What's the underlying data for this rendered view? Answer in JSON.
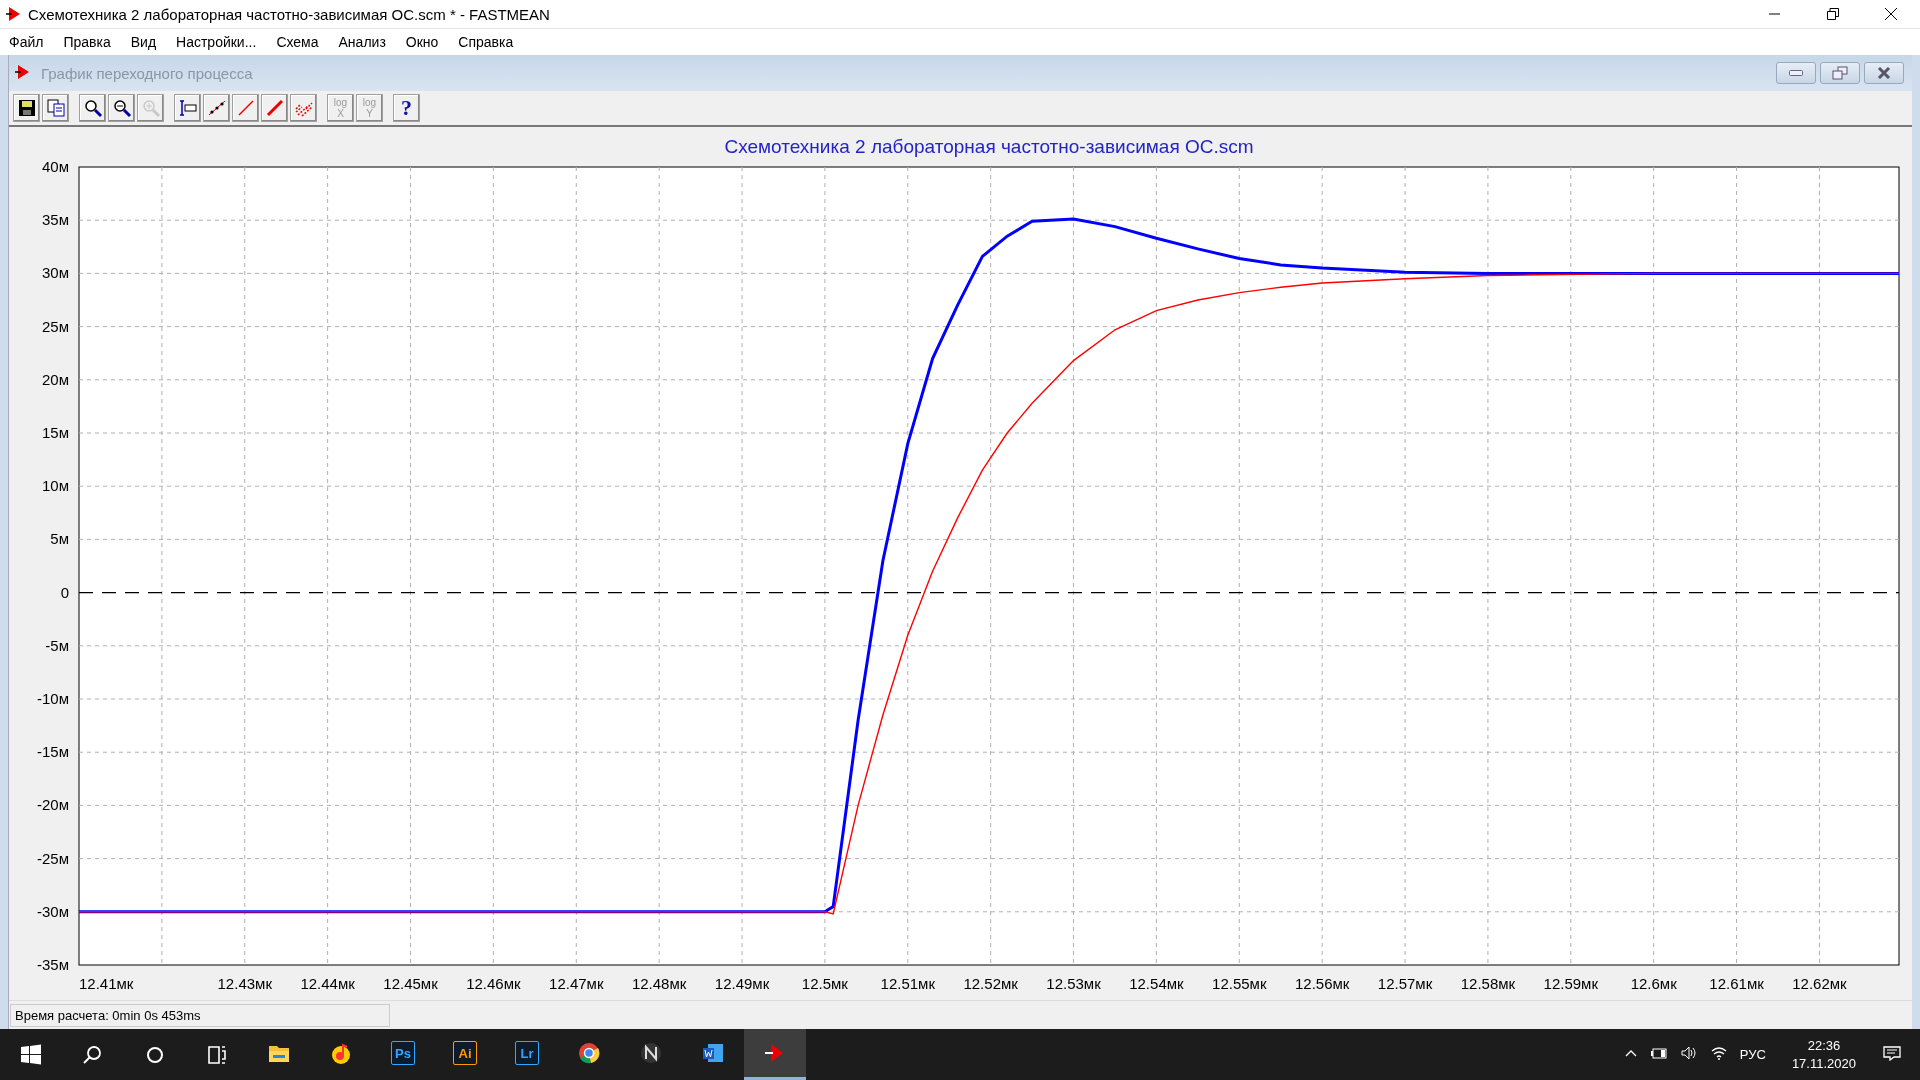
{
  "window": {
    "title": "Схемотехника 2 лабораторная частотно-зависимая ОС.scm * - FASTMEAN"
  },
  "menu": [
    "Файл",
    "Правка",
    "Вид",
    "Настройки...",
    "Схема",
    "Анализ",
    "Окно",
    "Справка"
  ],
  "child_window": {
    "title": "График переходного процесса"
  },
  "toolbar": [
    {
      "kind": "save",
      "disabled": false
    },
    {
      "kind": "copy",
      "disabled": false
    },
    {
      "kind": "zoom",
      "disabled": false
    },
    {
      "kind": "zoom-out",
      "disabled": false
    },
    {
      "kind": "zoom-in",
      "disabled": true
    },
    {
      "kind": "cursor",
      "disabled": false
    },
    {
      "kind": "points",
      "disabled": false
    },
    {
      "kind": "line",
      "disabled": false
    },
    {
      "kind": "thick-line",
      "disabled": false
    },
    {
      "kind": "hatch",
      "disabled": false
    },
    {
      "kind": "log",
      "label": "log X",
      "disabled": true
    },
    {
      "kind": "log",
      "label": "log Y",
      "disabled": true
    },
    {
      "kind": "help",
      "label": "?",
      "disabled": false
    }
  ],
  "chart": {
    "chart_data": {
      "type": "line",
      "title": "Схемотехника 2 лабораторная частотно-зависимая ОС.scm",
      "x": [
        12.41,
        12.5,
        12.501,
        12.504,
        12.507,
        12.51,
        12.513,
        12.516,
        12.519,
        12.522,
        12.525,
        12.53,
        12.535,
        12.54,
        12.545,
        12.55,
        12.555,
        12.56,
        12.57,
        12.58,
        12.6,
        12.6296
      ],
      "series": [
        {
          "color": "#0000ff",
          "values": [
            -30,
            -30,
            -29.5,
            -12,
            3,
            14,
            22,
            27,
            31.6,
            33.5,
            34.9,
            35.1,
            34.4,
            33.3,
            32.3,
            31.4,
            30.8,
            30.5,
            30.1,
            30,
            30,
            30
          ]
        },
        {
          "color": "#ff0000",
          "values": [
            -30,
            -30,
            -30.2,
            -20,
            -11.5,
            -4,
            2,
            7,
            11.5,
            15,
            17.8,
            21.8,
            24.7,
            26.5,
            27.5,
            28.2,
            28.7,
            29.1,
            29.5,
            29.8,
            30,
            30
          ]
        }
      ],
      "xlim": [
        12.41,
        12.6296
      ],
      "ylim": [
        -35,
        40
      ],
      "grid": true,
      "ref_lines": [
        {
          "axis": "y",
          "value": 0
        }
      ],
      "xticks": [
        {
          "value": 12.41,
          "label": "12.41мк"
        },
        {
          "value": 12.43,
          "label": "12.43мк"
        },
        {
          "value": 12.44,
          "label": "12.44мк"
        },
        {
          "value": 12.45,
          "label": "12.45мк"
        },
        {
          "value": 12.46,
          "label": "12.46мк"
        },
        {
          "value": 12.47,
          "label": "12.47мк"
        },
        {
          "value": 12.48,
          "label": "12.48мк"
        },
        {
          "value": 12.49,
          "label": "12.49мк"
        },
        {
          "value": 12.5,
          "label": "12.5мк"
        },
        {
          "value": 12.51,
          "label": "12.51мк"
        },
        {
          "value": 12.52,
          "label": "12.52мк"
        },
        {
          "value": 12.53,
          "label": "12.53мк"
        },
        {
          "value": 12.54,
          "label": "12.54мк"
        },
        {
          "value": 12.55,
          "label": "12.55мк"
        },
        {
          "value": 12.56,
          "label": "12.56мк"
        },
        {
          "value": 12.57,
          "label": "12.57мк"
        },
        {
          "value": 12.58,
          "label": "12.58мк"
        },
        {
          "value": 12.59,
          "label": "12.59мк"
        },
        {
          "value": 12.6,
          "label": "12.6мк"
        },
        {
          "value": 12.61,
          "label": "12.61мк"
        },
        {
          "value": 12.62,
          "label": "12.62мк"
        }
      ],
      "yticks": [
        {
          "value": 40,
          "label": "40м"
        },
        {
          "value": 35,
          "label": "35м"
        },
        {
          "value": 30,
          "label": "30м"
        },
        {
          "value": 25,
          "label": "25м"
        },
        {
          "value": 20,
          "label": "20м"
        },
        {
          "value": 15,
          "label": "15м"
        },
        {
          "value": 10,
          "label": "10м"
        },
        {
          "value": 5,
          "label": "5м"
        },
        {
          "value": 0,
          "label": "0"
        },
        {
          "value": -5,
          "label": "-5м"
        },
        {
          "value": -10,
          "label": "-10м"
        },
        {
          "value": -15,
          "label": "-15м"
        },
        {
          "value": -20,
          "label": "-20м"
        },
        {
          "value": -25,
          "label": "-25м"
        },
        {
          "value": -30,
          "label": "-30м"
        },
        {
          "value": -35,
          "label": "-35м"
        }
      ]
    }
  },
  "status_bar": {
    "text": "Время расчета: 0min 0s 453ms"
  },
  "taskbar": {
    "apps": [
      {
        "kind": "folder",
        "selected": false
      },
      {
        "kind": "music",
        "selected": false
      },
      {
        "kind": "letters",
        "label": "Ps",
        "color": "#31a8ff",
        "selected": false
      },
      {
        "kind": "letters",
        "label": "Ai",
        "color": "#ff9a00",
        "selected": false
      },
      {
        "kind": "letters",
        "label": "Lr",
        "color": "#31a8ff",
        "selected": false
      },
      {
        "kind": "browser",
        "selected": false
      },
      {
        "kind": "n",
        "selected": false
      },
      {
        "kind": "word",
        "selected": false
      },
      {
        "kind": "fastmean",
        "selected": true
      }
    ],
    "language": "РУС",
    "time": "22:36",
    "date": "17.11.2020"
  }
}
